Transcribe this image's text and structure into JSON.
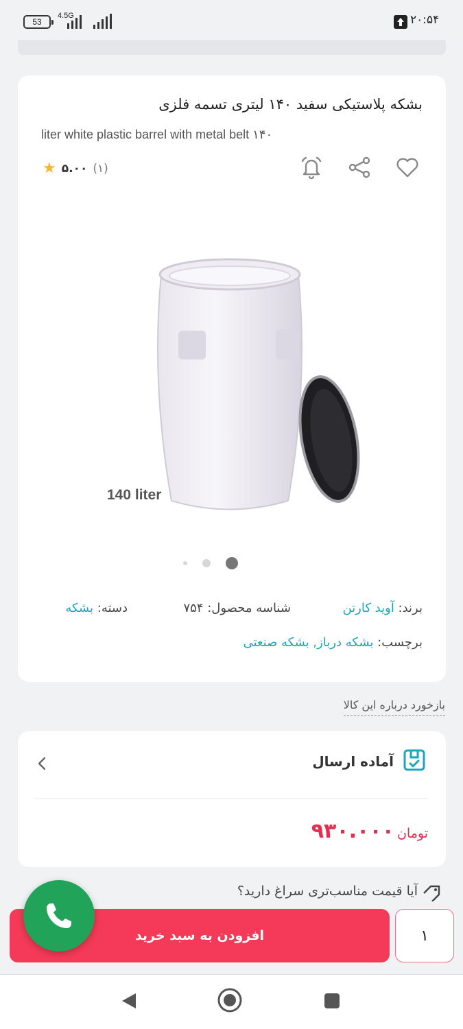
{
  "status_bar": {
    "battery": "53",
    "network": "4.5G",
    "time": "۲۰:۵۴"
  },
  "product": {
    "title_fa": "بشکه پلاستیکی سفید ۱۴۰ لیتری تسمه فلزی",
    "title_en": "liter white plastic barrel with metal belt ۱۴۰",
    "rating_score": "۵.۰۰",
    "rating_count": "(۱)",
    "image_caption": "140 liter",
    "brand_label": "برند:",
    "brand_value": "آوید کارتن",
    "sku_label": "شناسه محصول:",
    "sku_value": "۷۵۴",
    "category_label": "دسته:",
    "category_value": "بشکه",
    "tags_label": "برچسب:",
    "tags_value": "بشکه درباز, بشکه صنعتی",
    "icons": [
      "bell-icon",
      "share-icon",
      "heart-icon",
      "star-icon"
    ]
  },
  "feedback_link": "بازخورد درباره این کالا",
  "shipping": {
    "status": "آماده ارسال",
    "price": "۹۳۰.۰۰۰",
    "currency": "تومان"
  },
  "hint_text": "آیا قیمت مناسب‌تری سراغ دارید؟",
  "cart": {
    "add_label": "افزودن به سبد خرید",
    "quantity": "۱"
  },
  "colors": {
    "accent": "#f43a58",
    "link": "#1aa5b8",
    "call": "#21a35a",
    "price": "#e03052"
  }
}
